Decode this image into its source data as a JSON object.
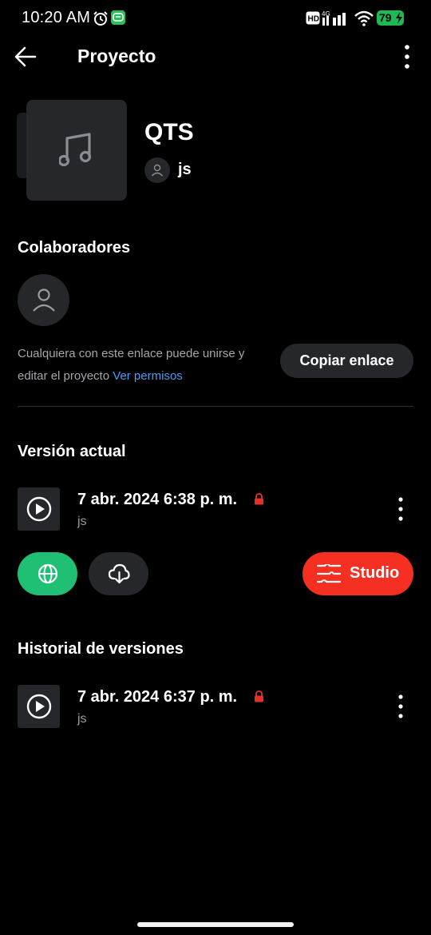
{
  "status_bar": {
    "time": "10:20 AM",
    "network": "4G",
    "battery": "79",
    "icons": [
      "alarm-icon",
      "message-icon",
      "hd-icon",
      "signal-icon",
      "wifi-icon",
      "battery-icon"
    ]
  },
  "app_bar": {
    "title": "Proyecto",
    "icons": [
      "back-arrow-icon",
      "more-vertical-icon"
    ]
  },
  "project": {
    "name": "QTS",
    "owner": "js",
    "cover_icon": "music-note-icon"
  },
  "collaborators": {
    "title": "Colaboradores",
    "share_text": "Cualquiera con este enlace puede unirse y editar el proyecto",
    "permissions_link": "Ver permisos",
    "copy_button": "Copiar enlace"
  },
  "current_version": {
    "title": "Versión actual",
    "date": "7 abr. 2024 6:38 p. m.",
    "author": "js",
    "locked": true,
    "actions": {
      "studio_label": "Studio",
      "icons": [
        "globe-icon",
        "cloud-download-icon",
        "studio-icon"
      ]
    }
  },
  "history": {
    "title": "Historial de versiones",
    "items": [
      {
        "date": "7 abr. 2024 6:37 p. m.",
        "author": "js",
        "locked": true
      }
    ]
  },
  "colors": {
    "background": "#000000",
    "surface": "#25272b",
    "accent_green": "#1fbf74",
    "accent_red": "#f52f21",
    "link_blue": "#4b9cf5",
    "lock_red": "#e5302a",
    "battery_green": "#1db954"
  }
}
